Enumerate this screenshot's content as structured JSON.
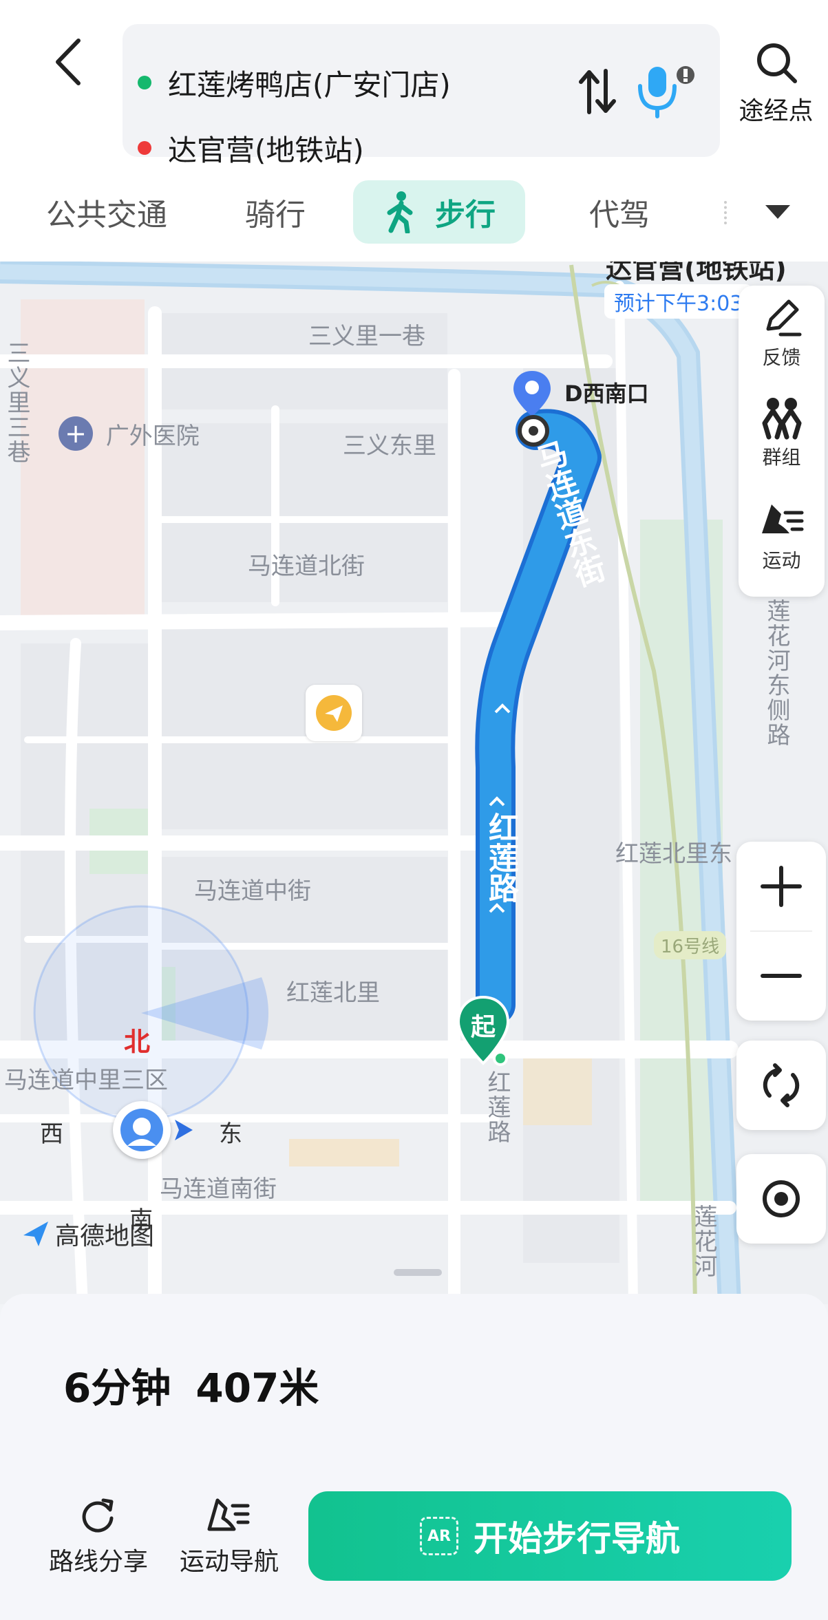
{
  "header": {
    "start_location": "红莲烤鸭店(广安门店)",
    "end_location": "达官营(地铁站)",
    "waypoint_label": "途经点",
    "colors": {
      "start_dot": "#15b86d",
      "end_dot": "#ee3a3a"
    }
  },
  "modes": [
    {
      "label": "公共交通",
      "active": false
    },
    {
      "label": "骑行",
      "active": false
    },
    {
      "label": "步行",
      "active": true
    },
    {
      "label": "代驾",
      "active": false
    }
  ],
  "map": {
    "destination_name": "达官营(地铁站)",
    "eta": "预计下午3:03",
    "exit_label": "D西南口",
    "start_marker": "起",
    "compass": {
      "north": "北",
      "west": "西",
      "east": "东",
      "south": "南"
    },
    "logo": "高德地图",
    "labels": {
      "sanyili_yixiang": "三义里一巷",
      "guangwai_hospital": "广外医院",
      "sanyi_dongli": "三义东里",
      "malian_beijie": "马连道北街",
      "malian_zhongjie": "马连道中街",
      "honglian_beili": "红莲北里",
      "malian_zhongli": "马连道中里三区",
      "malian_nanjie": "马连道南街",
      "honglian_beili_east": "红莲北里东",
      "line16": "16号线",
      "lianhuahe_east": "莲花河东侧路",
      "lianhuahe": "莲花河",
      "sanyili_san": "三义里三巷",
      "malian_dongjie": "马连道东街",
      "honglian_road": "红莲路",
      "honglian_road_small": "红莲路"
    },
    "side_panel": [
      {
        "label": "反馈",
        "icon": "pencil-icon"
      },
      {
        "label": "群组",
        "icon": "group-icon"
      },
      {
        "label": "运动",
        "icon": "sport-shoe-icon"
      }
    ]
  },
  "sheet": {
    "duration": "6分钟",
    "distance": "407米",
    "share_label": "路线分享",
    "sport_nav_label": "运动导航",
    "start_nav_label": "开始步行导航",
    "ar_label": "AR"
  }
}
